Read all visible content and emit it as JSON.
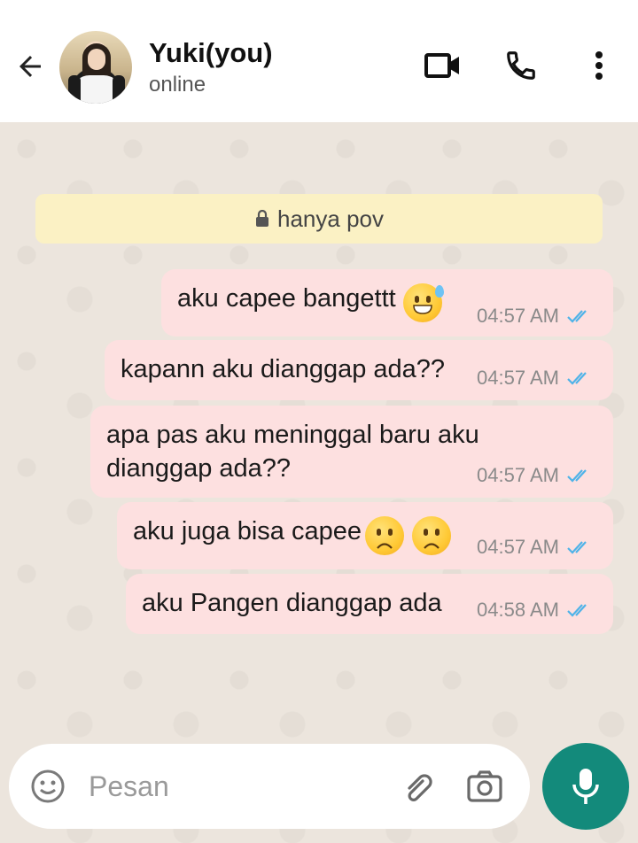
{
  "header": {
    "title": "Yuki(you)",
    "status": "online"
  },
  "icons": {
    "back": "arrow-left-icon",
    "video": "video-call-icon",
    "phone": "phone-icon",
    "more": "more-vertical-icon",
    "lock": "lock-icon",
    "emoji": "emoji-icon",
    "attach": "paperclip-icon",
    "camera": "camera-icon",
    "mic": "mic-icon",
    "read": "double-check-icon"
  },
  "system_message": "hanya pov",
  "messages": [
    {
      "text": "aku capee bangettt",
      "time": "04:57 AM",
      "emoji": "grinning-sweat"
    },
    {
      "text": "kapann aku dianggap ada??",
      "time": "04:57 AM"
    },
    {
      "text": "apa pas aku meninggal baru aku dianggap ada??",
      "time": "04:57 AM"
    },
    {
      "text": "aku juga bisa capee",
      "time": "04:57 AM",
      "emoji": "frowning-frowning"
    },
    {
      "text": "aku Pangen dianggap ada",
      "time": "04:58 AM"
    }
  ],
  "input": {
    "placeholder": "Pesan"
  },
  "colors": {
    "bubble": "#fde0e0",
    "system": "#fbf1c4",
    "accent": "#138a7b",
    "read_check": "#4fb3e8"
  }
}
